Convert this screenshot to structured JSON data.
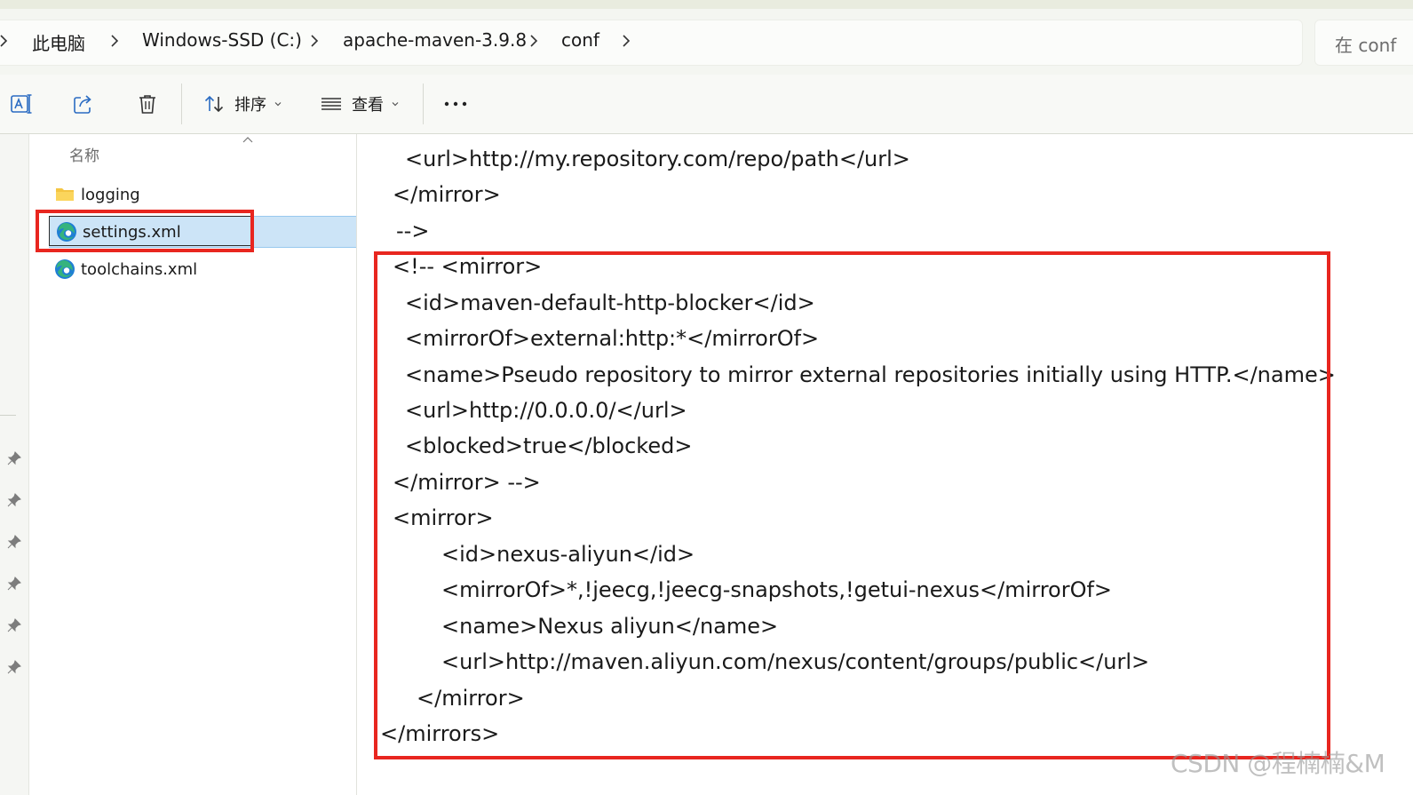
{
  "breadcrumb": {
    "items": [
      "此电脑",
      "Windows-SSD (C:)",
      "apache-maven-3.9.8",
      "conf"
    ]
  },
  "search": {
    "placeholder": "在 conf"
  },
  "toolbar": {
    "sort_label": "排序",
    "view_label": "查看"
  },
  "file_list": {
    "column_header": "名称",
    "items": [
      {
        "name": "logging",
        "type": "folder"
      },
      {
        "name": "settings.xml",
        "type": "edge-xml",
        "selected": true
      },
      {
        "name": "toolchains.xml",
        "type": "edge-xml"
      }
    ]
  },
  "preview": {
    "lines": [
      "<url>http://my.repository.com/repo/path</url>",
      "</mirror>",
      "-->",
      "<!-- <mirror>",
      "<id>maven-default-http-blocker</id>",
      "<mirrorOf>external:http:*</mirrorOf>",
      "<name>Pseudo repository to mirror external repositories initially using HTTP.</name>",
      "<url>http://0.0.0.0/</url>",
      "<blocked>true</blocked>",
      "</mirror> -->",
      "<mirror>",
      "<id>nexus-aliyun</id>",
      "<mirrorOf>*,!jeecg,!jeecg-snapshots,!getui-nexus</mirrorOf>",
      "<name>Nexus aliyun</name>",
      "<url>http://maven.aliyun.com/nexus/content/groups/public</url>",
      "</mirror>",
      "</mirrors>"
    ]
  },
  "watermark": "CSDN @程楠楠&M",
  "colors": {
    "annotation_red": "#e8261f",
    "selection_bg": "#cce4f7",
    "folder_yellow": "#f4c542",
    "edge_blue": "#1f7fd4",
    "edge_green": "#36b37e"
  },
  "icons": {
    "toolbar": [
      "rename-icon",
      "share-icon",
      "delete-icon",
      "sort-icon",
      "view-icon",
      "more-icon"
    ],
    "nav": [
      "pin-icon"
    ]
  }
}
